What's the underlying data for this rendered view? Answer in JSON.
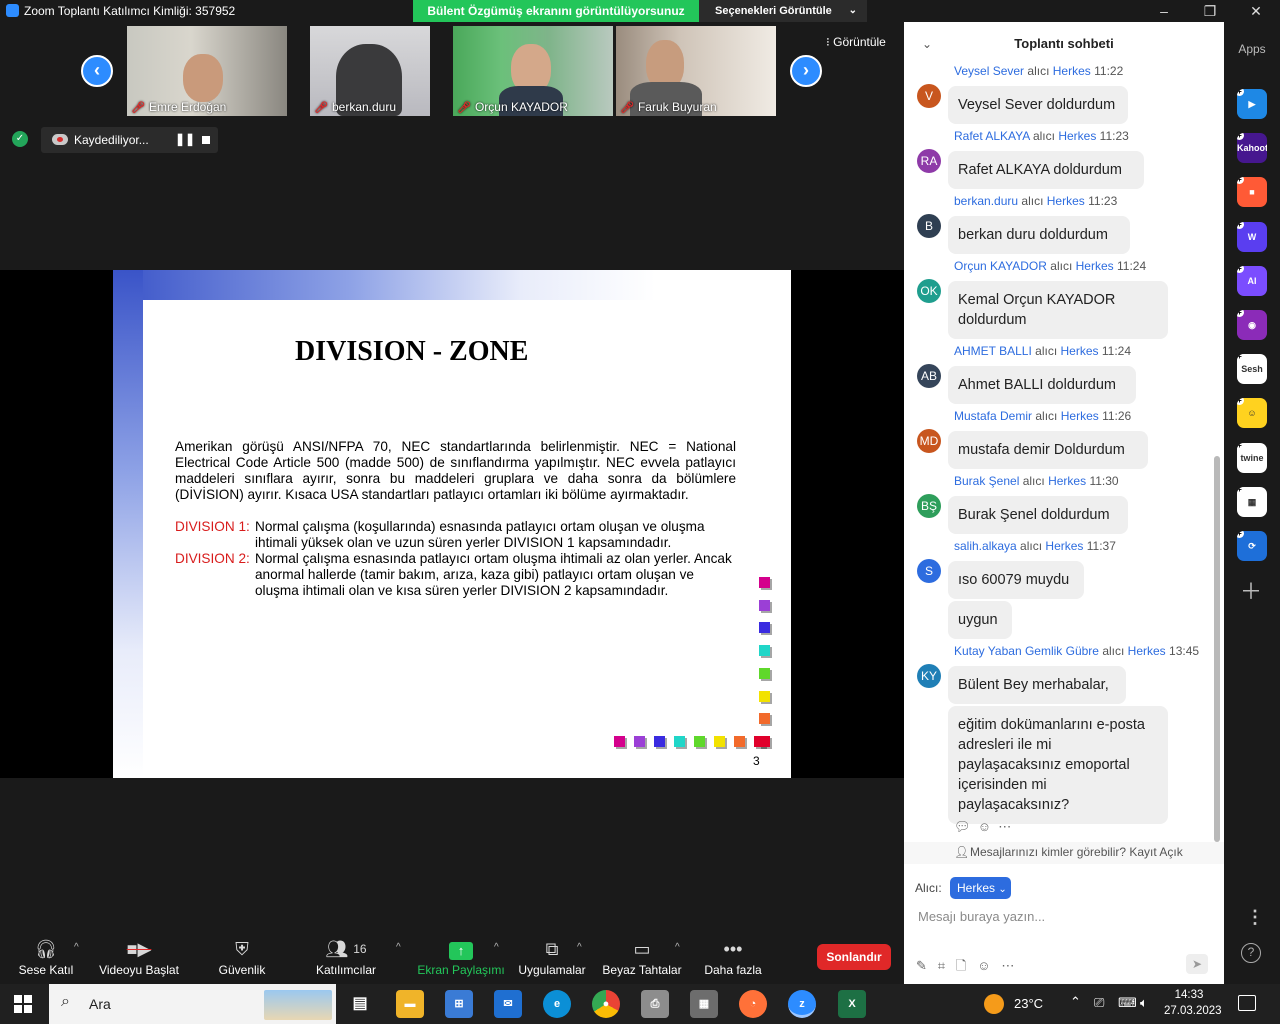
{
  "window": {
    "title": "Zoom Toplantı Katılımcı Kimliği: 357952",
    "share_banner": "Bülent Özgümüş ekranını görüntülüyorsunuz",
    "view_options": "Seçenekleri Görüntüle",
    "controls": {
      "minimize": "–",
      "restore": "❐",
      "close": "✕"
    }
  },
  "participants": [
    {
      "name": "Emre Erdoğan"
    },
    {
      "name": "berkan.duru"
    },
    {
      "name": "Orçun KAYADOR"
    },
    {
      "name": "Faruk Buyuran"
    }
  ],
  "video_nav": {
    "prev": "‹",
    "next": "›"
  },
  "view_toggle": "Görüntüle",
  "recording": {
    "label": "Kaydediliyor...",
    "pause": "❚❚"
  },
  "slide": {
    "title": "DIVISION - ZONE",
    "body": "Amerikan görüşü ANSI/NFPA 70, NEC standartlarında belirlenmiştir. NEC = National Electrical Code Article 500 (madde 500) de sınıflandırma yapılmıştır. NEC evvela patlayıcı maddeleri sınıflara ayırır, sonra bu maddeleri gruplara ve daha sonra da bölümlere (DİVİSION) ayırır. Kısaca USA standartları patlayıcı ortamları iki bölüme ayırmaktadır.",
    "divisions": [
      {
        "key": "DIVISION 1:",
        "text": "Normal çalışma (koşullarında) esnasında patlayıcı ortam oluşan ve oluşma ihtimali yüksek olan ve uzun süren yerler DIVISION 1 kapsamındadır."
      },
      {
        "key": "DIVISION 2:",
        "text": "Normal çalışma esnasında patlayıcı ortam oluşma ihtimali az olan yerler. Ancak anormal hallerde (tamir bakım, arıza, kaza gibi) patlayıcı ortam oluşan ve oluşma ihtimali olan ve kısa süren yerler DIVISION 2 kapsamındadır."
      }
    ],
    "page_number": "3",
    "decor_colors": [
      "#d4008c",
      "#9b3fd6",
      "#3a2be0",
      "#20d6c8",
      "#5fd82b",
      "#f2e200",
      "#f26a2b",
      "#e0002b"
    ]
  },
  "toolbar": {
    "audio": {
      "label": "Sese Katıl",
      "icon": "headphones-icon"
    },
    "video": {
      "label": "Videoyu Başlat",
      "icon": "video-off-icon"
    },
    "security": {
      "label": "Güvenlik",
      "icon": "shield-icon"
    },
    "participants": {
      "label": "Katılımcılar",
      "count": "16",
      "icon": "people-icon"
    },
    "share": {
      "label": "Ekran Paylaşımı",
      "icon": "share-screen-icon"
    },
    "apps": {
      "label": "Uygulamalar",
      "icon": "apps-icon"
    },
    "whiteboard": {
      "label": "Beyaz Tahtalar",
      "icon": "whiteboard-icon"
    },
    "more": {
      "label": "Daha fazla",
      "icon": "ellipsis-icon"
    },
    "end": "Sonlandır"
  },
  "chat": {
    "title": "Toplantı sohbeti",
    "to_word": "alıcı",
    "messages": [
      {
        "sender": "Veysel Sever",
        "to": "Herkes",
        "time": "11:22",
        "initials": "V",
        "color": "#c8561e",
        "texts": [
          "Veysel Sever doldurdum"
        ]
      },
      {
        "sender": "Rafet ALKAYA",
        "to": "Herkes",
        "time": "11:23",
        "initials": "RA",
        "color": "#8e3aa8",
        "texts": [
          "Rafet ALKAYA doldurdum"
        ]
      },
      {
        "sender": "berkan.duru",
        "to": "Herkes",
        "time": "11:23",
        "initials": "B",
        "color": "#2f3f52",
        "texts": [
          "berkan duru doldurdum"
        ]
      },
      {
        "sender": "Orçun KAYADOR",
        "to": "Herkes",
        "time": "11:24",
        "initials": "OK",
        "color": "#1f9e8e",
        "texts": [
          "Kemal Orçun KAYADOR doldurdum"
        ]
      },
      {
        "sender": "AHMET BALLI",
        "to": "Herkes",
        "time": "11:24",
        "initials": "AB",
        "color": "#35455a",
        "texts": [
          "Ahmet BALLI doldurdum"
        ]
      },
      {
        "sender": "Mustafa Demir",
        "to": "Herkes",
        "time": "11:26",
        "initials": "MD",
        "color": "#c8561e",
        "texts": [
          "mustafa demir Doldurdum"
        ]
      },
      {
        "sender": "Burak Şenel",
        "to": "Herkes",
        "time": "11:30",
        "initials": "BŞ",
        "color": "#2e9e5b",
        "texts": [
          "Burak Şenel doldurdum"
        ]
      },
      {
        "sender": "salih.alkaya",
        "to": "Herkes",
        "time": "11:37",
        "initials": "S",
        "color": "#2d6cdf",
        "texts": [
          "ıso 60079 muydu",
          "uygun"
        ]
      },
      {
        "sender": "Kutay Yaban Gemlik Gübre",
        "to": "Herkes",
        "time": "13:45",
        "initials": "KY",
        "color": "#1f7fb6",
        "texts": [
          "Bülent Bey merhabalar,",
          "eğitim dokümanlarını e-posta adresleri ile mi paylaşacaksınız emoportal içerisinden mi paylaşacaksınız?"
        ]
      }
    ],
    "visibility_note": "Mesajlarınızı kimler görebilir? Kayıt Açık",
    "recipient_label": "Alıcı:",
    "recipient_value": "Herkes",
    "input_placeholder": "Mesajı buraya yazın..."
  },
  "apps_rail": {
    "title": "Apps",
    "apps": [
      {
        "name": "Pitch",
        "color": "#1e88e5",
        "label": "▶"
      },
      {
        "name": "Kahoot!",
        "color": "#46178f",
        "label": "Kahoot!"
      },
      {
        "name": "Miro",
        "color": "#ff5a36",
        "label": "■"
      },
      {
        "name": "Wooclap",
        "color": "#5a3ef0",
        "label": "W"
      },
      {
        "name": "AI",
        "color": "#7b4dff",
        "label": "AI"
      },
      {
        "name": "Video",
        "color": "#8b2bb8",
        "label": "◉"
      },
      {
        "name": "Sesh",
        "color": "#ffffff",
        "label": "Sesh"
      },
      {
        "name": "Emoji",
        "color": "#ffd21f",
        "label": "☺"
      },
      {
        "name": "twine",
        "color": "#ffffff",
        "label": "twine"
      },
      {
        "name": "Apps Grid",
        "color": "#ffffff",
        "label": "▦"
      },
      {
        "name": "Sync",
        "color": "#1e6fd9",
        "label": "⟳"
      }
    ]
  },
  "taskbar": {
    "search_placeholder": "Ara",
    "weather": "23°C",
    "time": "14:33",
    "date": "27.03.2023"
  }
}
